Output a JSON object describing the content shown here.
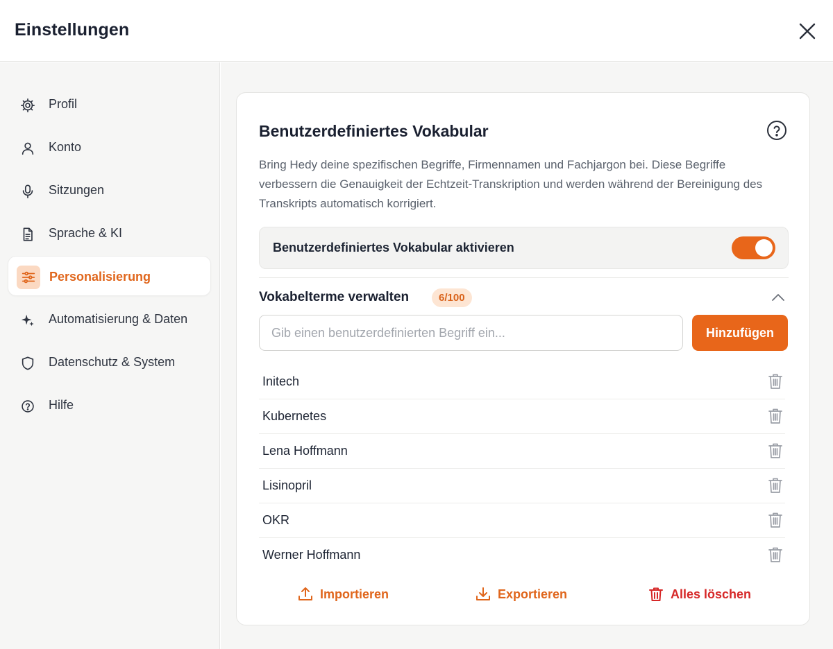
{
  "header": {
    "title": "Einstellungen",
    "close_icon": "close-icon"
  },
  "sidebar": {
    "items": [
      {
        "label": "Profil",
        "icon": "gear-icon",
        "active": false
      },
      {
        "label": "Konto",
        "icon": "user-icon",
        "active": false
      },
      {
        "label": "Sitzungen",
        "icon": "microphone-icon",
        "active": false
      },
      {
        "label": "Sprache & KI",
        "icon": "document-icon",
        "active": false
      },
      {
        "label": "Personalisierung",
        "icon": "sliders-icon",
        "active": true
      },
      {
        "label": "Automatisierung & Daten",
        "icon": "sparkle-icon",
        "active": false
      },
      {
        "label": "Datenschutz & System",
        "icon": "shield-icon",
        "active": false
      },
      {
        "label": "Hilfe",
        "icon": "help-icon",
        "active": false
      }
    ]
  },
  "card": {
    "title": "Benutzerdefiniertes Vokabular",
    "description": "Bring Hedy deine spezifischen Begriffe, Firmennamen und Fachjargon bei. Diese Begriffe verbessern die Genauigkeit der Echtzeit-Transkription und werden während der Bereinigung des Transkripts automatisch korrigiert.",
    "toggle_label": "Benutzerdefiniertes Vokabular aktivieren",
    "toggle_on": true,
    "section_title": "Vokabelterme verwalten",
    "count_badge": "6/100",
    "input_placeholder": "Gib einen benutzerdefinierten Begriff ein...",
    "input_value": "",
    "add_button": "Hinzufügen",
    "terms": [
      "Initech",
      "Kubernetes",
      "Lena Hoffmann",
      "Lisinopril",
      "OKR",
      "Werner Hoffmann"
    ],
    "actions": {
      "import": "Importieren",
      "export": "Exportieren",
      "clear": "Alles löschen"
    }
  },
  "colors": {
    "accent": "#e8661a",
    "danger": "#d62828",
    "badge_bg": "#fde5d3"
  }
}
